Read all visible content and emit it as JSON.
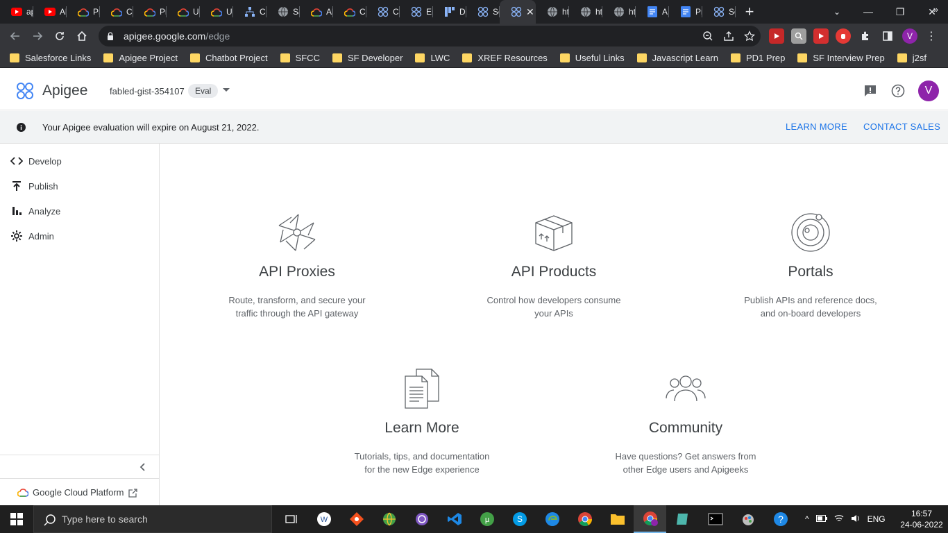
{
  "browser": {
    "tabs": [
      {
        "title": "ap",
        "icon": "youtube-icon"
      },
      {
        "title": "Al",
        "icon": "youtube-icon"
      },
      {
        "title": "Pr",
        "icon": "google-cloud-icon"
      },
      {
        "title": "Cl",
        "icon": "google-cloud-icon"
      },
      {
        "title": "Pr",
        "icon": "google-cloud-icon"
      },
      {
        "title": "U:",
        "icon": "google-cloud-icon"
      },
      {
        "title": "U:",
        "icon": "google-cloud-icon"
      },
      {
        "title": "Ce",
        "icon": "sitemap-icon"
      },
      {
        "title": "Sa",
        "icon": "globe-icon"
      },
      {
        "title": "Al",
        "icon": "google-cloud-icon"
      },
      {
        "title": "Cl",
        "icon": "google-cloud-icon"
      },
      {
        "title": "Cr",
        "icon": "apigee-icon"
      },
      {
        "title": "Er",
        "icon": "apigee-icon"
      },
      {
        "title": "D",
        "icon": "grid-icon"
      },
      {
        "title": "Se",
        "icon": "apigee-icon"
      },
      {
        "title": "",
        "icon": "apigee-icon",
        "active": true
      },
      {
        "title": "ht",
        "icon": "globe-icon"
      },
      {
        "title": "ht",
        "icon": "globe-icon"
      },
      {
        "title": "ht",
        "icon": "globe-icon"
      },
      {
        "title": "A|",
        "icon": "docs-icon"
      },
      {
        "title": "Pr",
        "icon": "docs-icon"
      },
      {
        "title": "Se",
        "icon": "apigee-icon"
      }
    ],
    "url_host": "apigee.google.com",
    "url_path": "/edge",
    "profile_initial": "V",
    "bookmarks": [
      {
        "label": "Salesforce Links"
      },
      {
        "label": "Apigee Project"
      },
      {
        "label": "Chatbot Project"
      },
      {
        "label": "SFCC"
      },
      {
        "label": "SF Developer"
      },
      {
        "label": "LWC"
      },
      {
        "label": "XREF Resources"
      },
      {
        "label": "Useful Links"
      },
      {
        "label": "Javascript Learn"
      },
      {
        "label": "PD1 Prep"
      },
      {
        "label": "SF Interview Prep"
      },
      {
        "label": "j2sf"
      }
    ],
    "bookmarks_more": "»"
  },
  "header": {
    "brand": "Apigee",
    "project": "fabled-gist-354107",
    "badge": "Eval",
    "avatar_initial": "V"
  },
  "banner": {
    "message": "Your Apigee evaluation will expire on August 21, 2022.",
    "learn_more": "LEARN MORE",
    "contact_sales": "CONTACT SALES"
  },
  "sidebar": {
    "items": [
      {
        "label": "Develop",
        "icon": "code-icon"
      },
      {
        "label": "Publish",
        "icon": "publish-icon"
      },
      {
        "label": "Analyze",
        "icon": "bar-chart-icon"
      },
      {
        "label": "Admin",
        "icon": "gear-icon"
      }
    ],
    "footer_link": "Google Cloud Platform"
  },
  "cards": [
    {
      "title": "API Proxies",
      "desc": "Route, transform, and secure your\ntraffic through the API gateway",
      "icon": "aperture-icon"
    },
    {
      "title": "API Products",
      "desc": "Control how developers consume\nyour APIs",
      "icon": "package-icon"
    },
    {
      "title": "Portals",
      "desc": "Publish APIs and reference docs,\nand on-board developers",
      "icon": "orbit-icon"
    },
    {
      "title": "Learn More",
      "desc": "Tutorials, tips, and documentation\nfor the new Edge experience",
      "icon": "documents-icon"
    },
    {
      "title": "Community",
      "desc": "Have questions? Get answers from\nother Edge users and Apigeeks",
      "icon": "people-icon"
    }
  ],
  "taskbar": {
    "search_placeholder": "Type here to search",
    "language": "ENG",
    "time": "16:57",
    "date": "24-06-2022"
  },
  "colors": {
    "accent": "#1a73e8",
    "avatar": "#8e24aa",
    "banner_bg": "#f1f3f4"
  }
}
